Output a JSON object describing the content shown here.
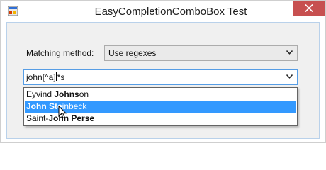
{
  "window": {
    "title": "EasyCompletionComboBox Test",
    "close_glyph": "✕",
    "icon": "winforms-app-icon"
  },
  "form": {
    "method_label": "Matching method:",
    "method_value": "Use regexes",
    "search_text_before_caret": "john[^a]",
    "search_text_after_caret": "*s"
  },
  "dropdown": {
    "items": [
      {
        "parts": [
          "Eyvind ",
          "Johns",
          "on"
        ],
        "bold": [
          false,
          true,
          false
        ],
        "selected": false
      },
      {
        "parts": [
          "John Ste",
          "inbeck"
        ],
        "bold": [
          true,
          false
        ],
        "selected": true
      },
      {
        "parts": [
          "Saint-",
          "John Perse"
        ],
        "bold": [
          false,
          true
        ],
        "selected": false
      }
    ]
  },
  "colors": {
    "selection": "#3399ff",
    "close_button": "#c75050",
    "focus_border": "#569de5"
  }
}
